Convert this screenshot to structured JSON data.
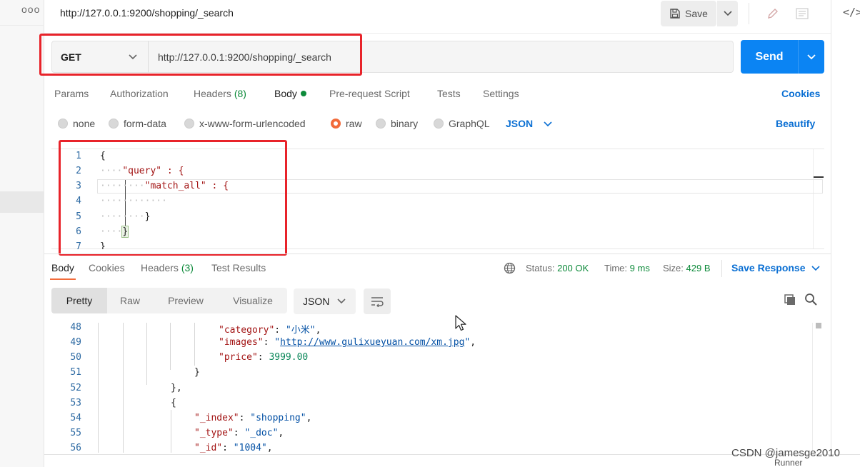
{
  "window": {
    "more_label": "ooo",
    "code_label": "</>"
  },
  "header": {
    "title": "http://127.0.0.1:9200/shopping/_search",
    "save_label": "Save"
  },
  "request": {
    "method": "GET",
    "url": "http://127.0.0.1:9200/shopping/_search",
    "send_label": "Send",
    "tabs": [
      {
        "label": "Params"
      },
      {
        "label": "Authorization"
      },
      {
        "label": "Headers",
        "count": "(8)"
      },
      {
        "label": "Body"
      },
      {
        "label": "Pre-request Script"
      },
      {
        "label": "Tests"
      },
      {
        "label": "Settings"
      }
    ],
    "cookies_label": "Cookies",
    "body_modes": [
      "none",
      "form-data",
      "x-www-form-urlencoded",
      "raw",
      "binary",
      "GraphQL"
    ],
    "selected_body_mode": "raw",
    "language": "JSON",
    "beautify_label": "Beautify",
    "editor": {
      "line_numbers": [
        "1",
        "2",
        "3",
        "4",
        "5",
        "6",
        "7"
      ],
      "lines": [
        "{",
        "\"query\" : {",
        "\"match_all\" : {",
        "",
        "}",
        "}",
        "}"
      ]
    }
  },
  "response": {
    "tabs": [
      {
        "label": "Body"
      },
      {
        "label": "Cookies"
      },
      {
        "label": "Headers",
        "count": "(3)"
      },
      {
        "label": "Test Results"
      }
    ],
    "status_label": "Status:",
    "status_value": "200 OK",
    "time_label": "Time:",
    "time_value": "9 ms",
    "size_label": "Size:",
    "size_value": "429 B",
    "save_response_label": "Save Response",
    "views": [
      "Pretty",
      "Raw",
      "Preview",
      "Visualize"
    ],
    "format": "JSON",
    "code": {
      "line_numbers": [
        "48",
        "49",
        "50",
        "51",
        "52",
        "53",
        "54",
        "55",
        "56"
      ],
      "k_category": "\"category\"",
      "v_category": "\"小米\"",
      "k_images": "\"images\"",
      "v_images": "http://www.gulixueyuan.com/xm.jpg",
      "k_price": "\"price\"",
      "v_price": "3999.00",
      "k_index": "\"_index\"",
      "v_index": "\"shopping\"",
      "k_type": "\"_type\"",
      "v_type": "\"_doc\"",
      "k_id": "\"_id\"",
      "v_id": "\"1004\""
    }
  },
  "footer": {
    "runner_label": "Runner",
    "watermark": "CSDN @jamesge2010"
  },
  "colors": {
    "accent_blue": "#0b84f3",
    "link_blue": "#0a6fd3",
    "highlight_red": "#e8232a",
    "status_green": "#0d8a3a",
    "active_orange": "#f26b3a"
  }
}
